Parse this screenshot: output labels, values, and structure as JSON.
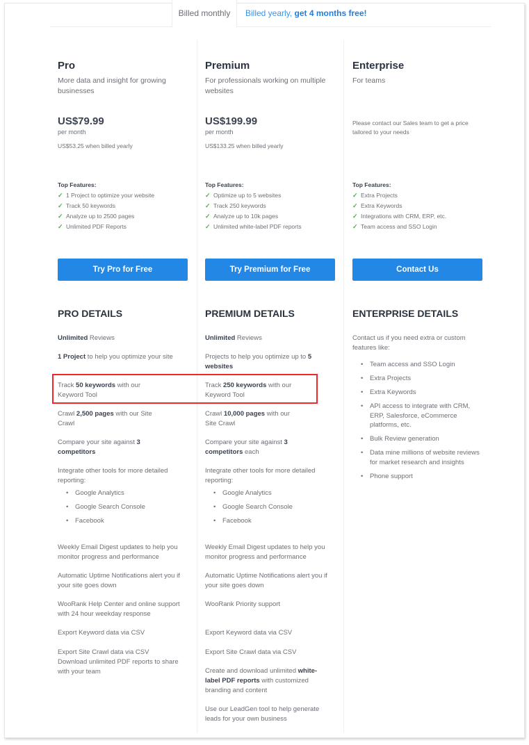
{
  "billing_tabs": {
    "monthly": "Billed monthly",
    "yearly_prefix": "Billed yearly, ",
    "yearly_bold": "get 4 months free!"
  },
  "top_features_label": "Top Features:",
  "plans": {
    "pro": {
      "name": "Pro",
      "description": "More data and insight for growing businesses",
      "price": "US$79.99",
      "period": "per month",
      "yearly": "US$53.25 when billed yearly",
      "features": [
        "1 Project to optimize your website",
        "Track 50 keywords",
        "Analyze up to 2500 pages",
        "Unlimited PDF Reports"
      ],
      "cta": "Try Pro for Free",
      "details_title": "PRO DETAILS",
      "details": {
        "reviews_b": "Unlimited",
        "reviews": " Reviews",
        "project_b": "1 Project",
        "project": " to help you optimize your site",
        "track_pre": "Track ",
        "track_b": "50 keywords",
        "track_post": " with our Keyword Tool",
        "crawl_pre": "Crawl ",
        "crawl_b": "2,500 pages",
        "crawl_post": " with our Site Crawl",
        "compare_pre": "Compare your site against ",
        "compare_b": "3 competitors",
        "compare_post": "",
        "integrate": "Integrate other tools for more detailed reporting:",
        "integrations": [
          "Google Analytics",
          "Google Search Console",
          "Facebook"
        ],
        "digest": "Weekly Email Digest updates to help you monitor progress and performance",
        "uptime": "Automatic Uptime Notifications alert you if your site goes down",
        "support": "WooRank Help Center and online support with 24 hour weekday response",
        "export_kw": "Export Keyword data via CSV",
        "export_crawl": "Export Site Crawl data via CSV",
        "pdf": "Download unlimited PDF reports to share with your team"
      }
    },
    "premium": {
      "name": "Premium",
      "description": "For professionals working on multiple websites",
      "price": "US$199.99",
      "period": "per month",
      "yearly": "US$133.25 when billed yearly",
      "features": [
        "Optimize up to 5 websites",
        "Track 250 keywords",
        "Analyze up to 10k pages",
        "Unlimited white-label PDF reports"
      ],
      "cta": "Try Premium for Free",
      "details_title": "PREMIUM DETAILS",
      "details": {
        "reviews_b": "Unlimited",
        "reviews": " Reviews",
        "project_pre": "Projects to help you optimize up to ",
        "project_b": "5 websites",
        "track_pre": "Track ",
        "track_b": "250 keywords",
        "track_post": " with our Keyword Tool",
        "crawl_pre": "Crawl ",
        "crawl_b": "10,000 pages",
        "crawl_post": " with our Site Crawl",
        "compare_pre": "Compare your site against ",
        "compare_b": "3 competitors",
        "compare_post": " each",
        "integrate": "Integrate other tools for more detailed reporting:",
        "integrations": [
          "Google Analytics",
          "Google Search Console",
          "Facebook"
        ],
        "digest": "Weekly Email Digest updates to help you monitor progress and performance",
        "uptime": "Automatic Uptime Notifications alert you if your site goes down",
        "support": "WooRank Priority support",
        "export_kw": "Export Keyword data via CSV",
        "export_crawl": "Export Site Crawl data via CSV",
        "pdf_pre": "Create and download unlimited ",
        "pdf_b": "white-label PDF reports",
        "pdf_post": " with customized branding and content",
        "leadgen": "Use our LeadGen tool to help generate leads for your own business"
      }
    },
    "enterprise": {
      "name": "Enterprise",
      "description": "For teams",
      "contact_note": "Please contact our Sales team to get a price tailored to your needs",
      "features": [
        "Extra Projects",
        "Extra Keywords",
        "Integrations with CRM, ERP, etc.",
        "Team access and SSO Login"
      ],
      "cta": "Contact Us",
      "details_title": "ENTERPRISE DETAILS",
      "details_intro": "Contact us if you need extra or custom features like:",
      "details_list": [
        "Team access and SSO Login",
        "Extra Projects",
        "Extra Keywords",
        "API access to integrate with CRM, ERP, Salesforce, eCommerce platforms, etc.",
        "Bulk Review generation",
        "Data mine millions of website reviews for market research and insights",
        "Phone support"
      ]
    }
  },
  "colors": {
    "accent": "#2387e6",
    "check": "#4caf50",
    "highlight": "#f02828"
  }
}
